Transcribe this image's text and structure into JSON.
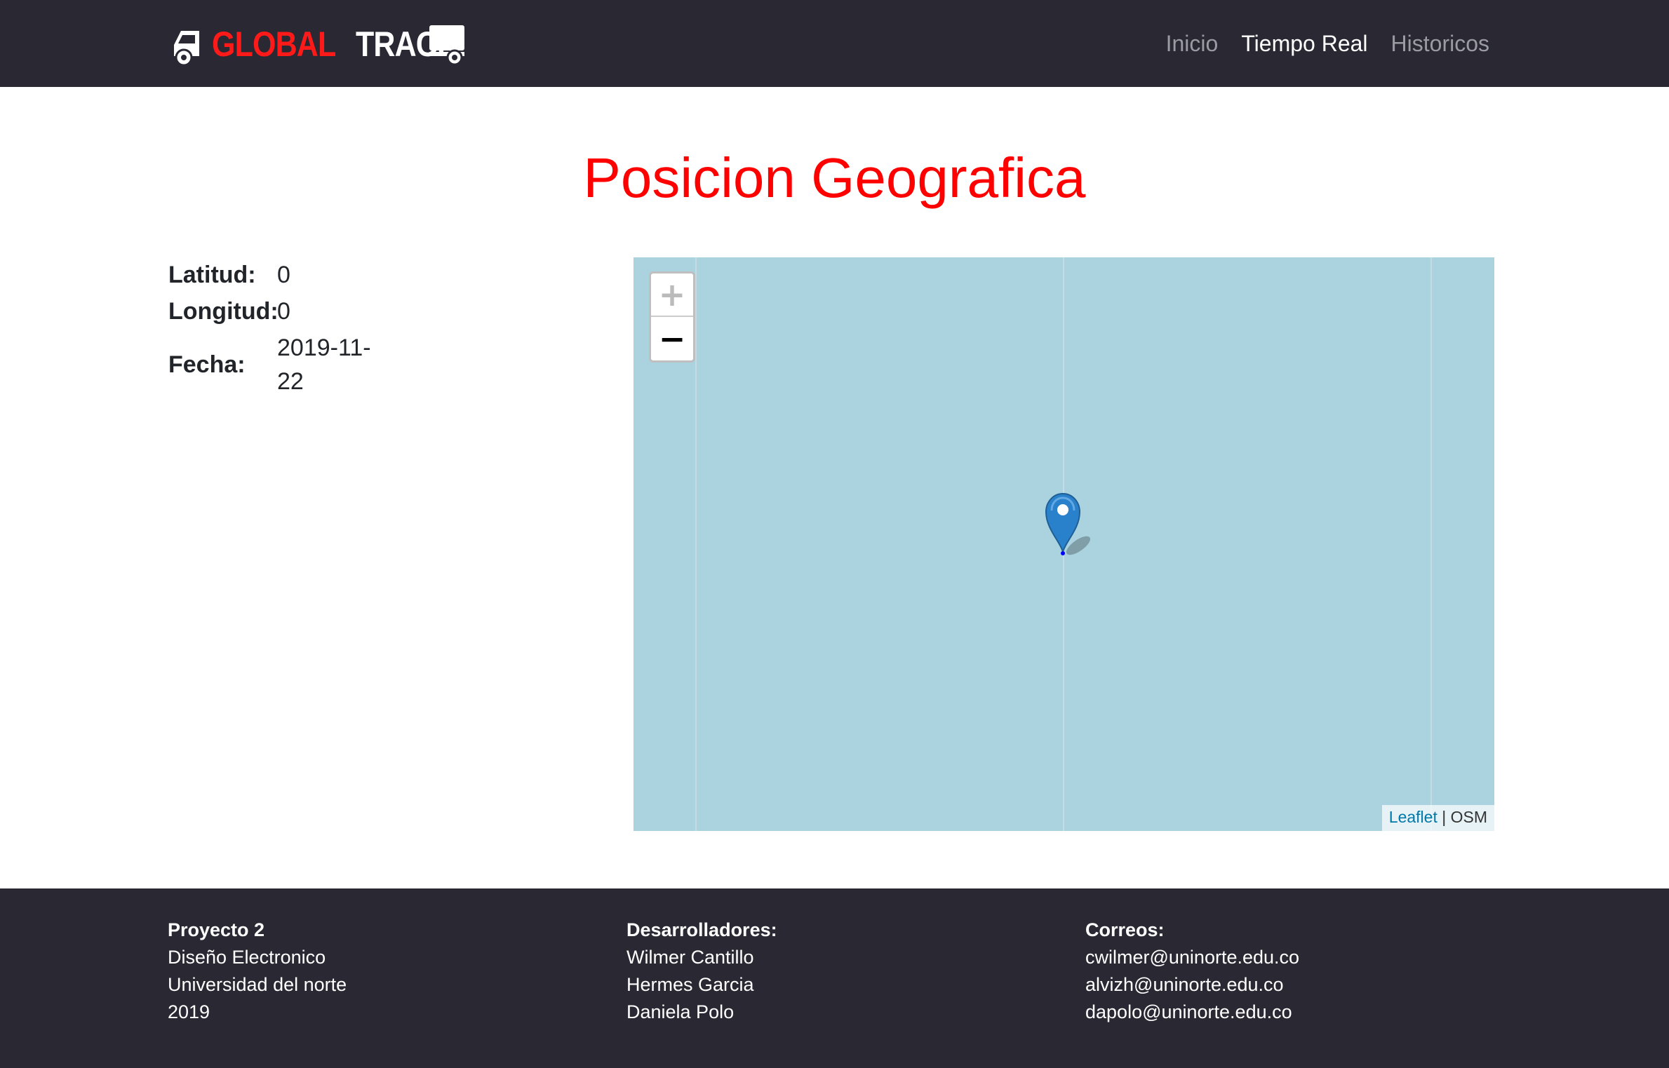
{
  "header": {
    "logo": {
      "word_red": "GLOBAL",
      "word_white": "TRACK",
      "icon": "truck-icon"
    },
    "nav": [
      {
        "label": "Inicio"
      },
      {
        "label": "Tiempo Real"
      },
      {
        "label": "Historicos"
      }
    ],
    "active_index": 1
  },
  "main": {
    "title": "Posicion Geografica",
    "info": {
      "lat_label": "Latitud:",
      "lat_value": "0",
      "lon_label": "Longitud:",
      "lon_value": "0",
      "date_label": "Fecha:",
      "date_value": "2019-11-22"
    }
  },
  "map": {
    "zoom_in": "+",
    "zoom_out": "−",
    "attribution": {
      "link": "Leaflet",
      "separator": " | ",
      "source": "OSM"
    },
    "marker": {
      "lat": 0,
      "lon": 0,
      "icon": "map-marker-icon"
    }
  },
  "footer": {
    "col1": {
      "title": "Proyecto 2",
      "lines": [
        "Diseño Electronico",
        "Universidad del norte",
        "2019"
      ]
    },
    "col2": {
      "title": "Desarrolladores:",
      "lines": [
        "Wilmer Cantillo",
        "Hermes Garcia",
        "Daniela Polo"
      ]
    },
    "col3": {
      "title": "Correos:",
      "lines": [
        "cwilmer@uninorte.edu.co",
        "alvizh@uninorte.edu.co",
        "dapolo@uninorte.edu.co"
      ]
    }
  },
  "colors": {
    "navbar_bg": "#292833",
    "title_red": "#ff0000",
    "map_water": "#aad3df",
    "leaflet_link": "#0078a8",
    "marker_blue": "#2a81cb"
  }
}
